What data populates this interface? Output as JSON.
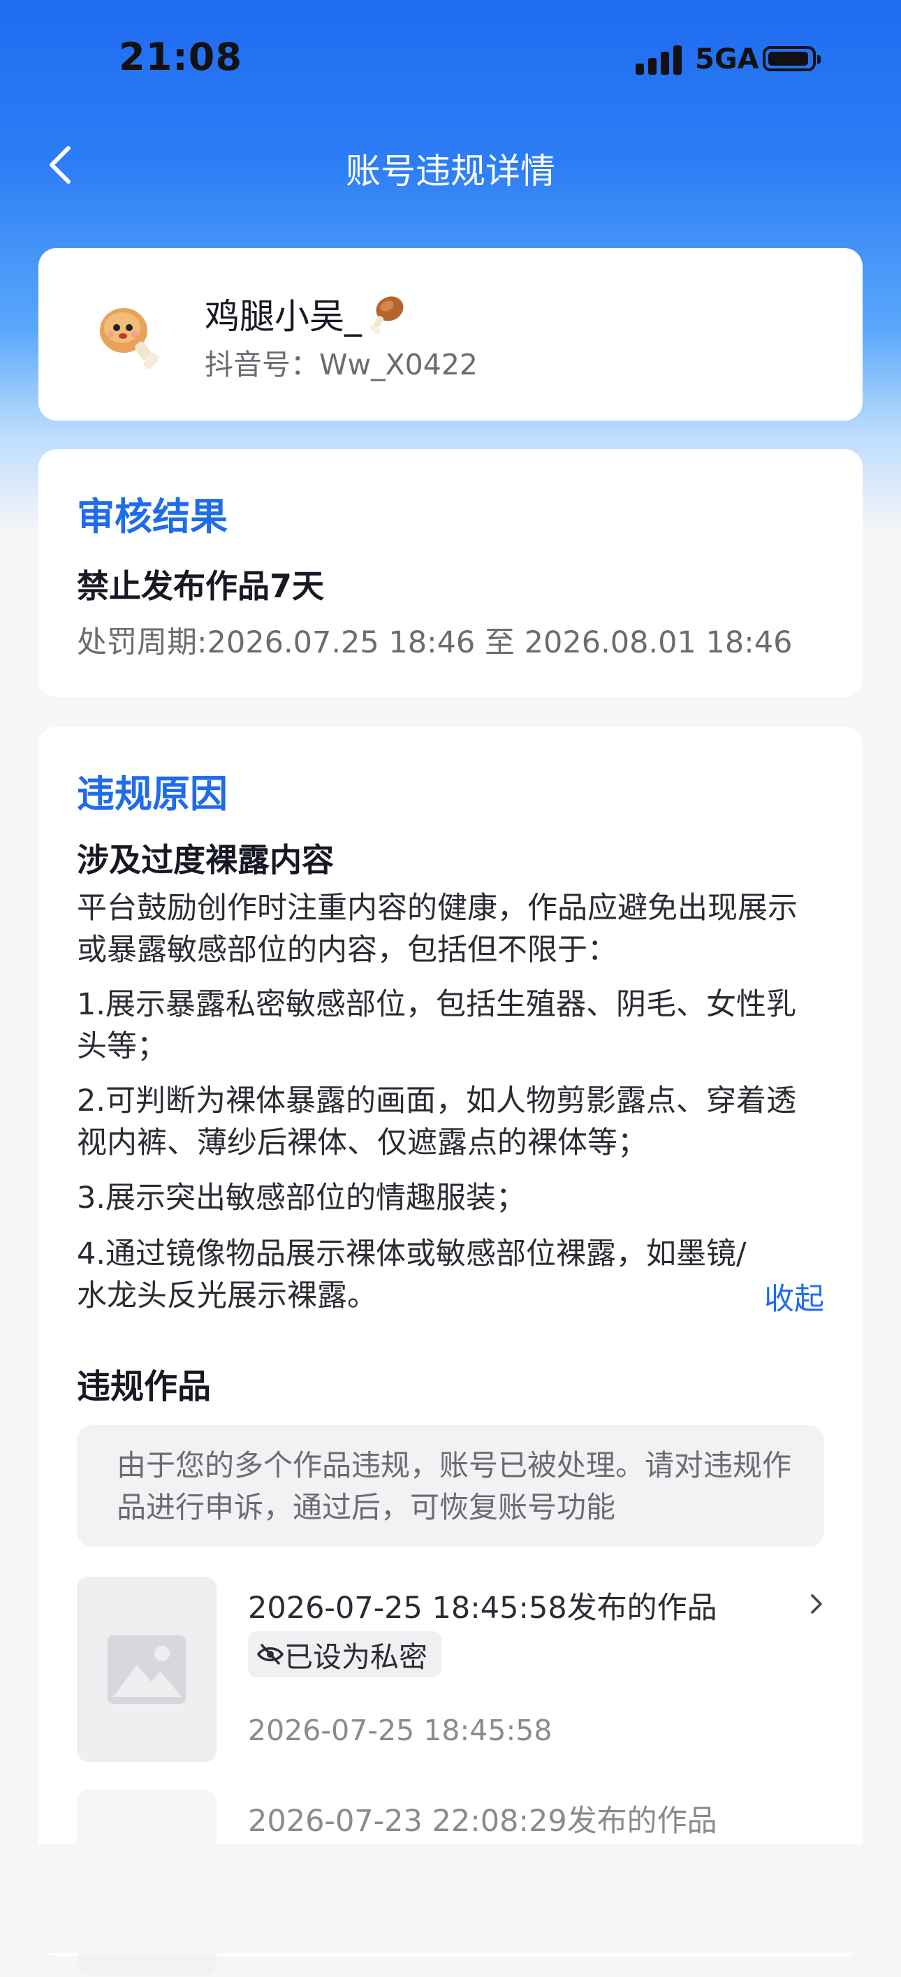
{
  "status_bar": {
    "time": "21:08",
    "network": "5GA",
    "battery_level": 0.95
  },
  "header": {
    "title": "账号违规详情",
    "back_icon": "chevron-left-icon"
  },
  "profile": {
    "username": "鸡腿小吴_",
    "id_label": "抖音号：",
    "id_value": "Ww_X0422",
    "avatar_icon": "chicken-leg-character-icon",
    "name_emoji_icon": "drumstick-icon"
  },
  "audit": {
    "title": "审核结果",
    "result": "禁止发布作品7天",
    "period_label": "处罚周期:",
    "period_start": "2026.07.25 18:46",
    "period_to": "至",
    "period_end": "2026.08.01 18:46"
  },
  "reason": {
    "title": "违规原因",
    "subtitle": "涉及过度裸露内容",
    "intro": "平台鼓励创作时注重内容的健康，作品应避免出现展示或暴露敏感部位的内容，包括但不限于：",
    "items": [
      "1.展示暴露私密敏感部位，包括生殖器、阴毛、女性乳头等；",
      "2.可判断为裸体暴露的画面，如人物剪影露点、穿着透视内裤、薄纱后裸体、仅遮露点的裸体等；",
      "3.展示突出敏感部位的情趣服装；",
      "4.通过镜像物品展示裸体或敏感部位裸露，如墨镜/水龙头反光展示裸露。"
    ],
    "collapse_label": "收起"
  },
  "works": {
    "title": "违规作品",
    "notice": "由于您的多个作品违规，账号已被处理。请对违规作品进行申诉，通过后，可恢复账号功能",
    "items": [
      {
        "title": "2026-07-25 18:45:58发布的作品",
        "badge": "已设为私密",
        "date": "2026-07-25 18:45:58"
      },
      {
        "title": "2026-07-23 22:08:29发布的作品"
      }
    ]
  },
  "colors": {
    "accent": "#1f6ceb",
    "header_blue": "#1f6cf0",
    "background": "#f5f6f8"
  }
}
